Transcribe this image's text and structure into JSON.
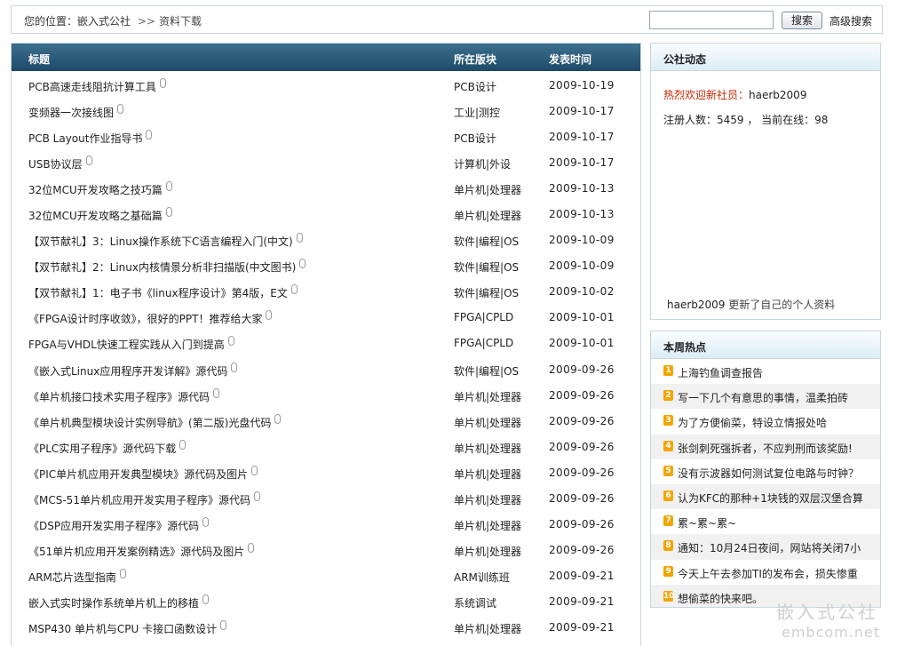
{
  "breadcrumb": {
    "prefix": "您的位置：",
    "site": "嵌入式公社",
    "separator": ">>",
    "current": "资料下载"
  },
  "search": {
    "value": "",
    "button": "搜索",
    "advanced": "高级搜索"
  },
  "table": {
    "headers": {
      "title": "标题",
      "forum": "所在版块",
      "date": "发表时间"
    },
    "rows": [
      {
        "title": "PCB高速走线阻抗计算工具",
        "forum": "PCB设计",
        "date": "2009-10-19"
      },
      {
        "title": "变频器一次接线图",
        "forum": "工业|测控",
        "date": "2009-10-17"
      },
      {
        "title": "PCB Layout作业指导书",
        "forum": "PCB设计",
        "date": "2009-10-17"
      },
      {
        "title": "USB协议层",
        "forum": "计算机|外设",
        "date": "2009-10-17"
      },
      {
        "title": "32位MCU开发攻略之技巧篇",
        "forum": "单片机|处理器",
        "date": "2009-10-13"
      },
      {
        "title": "32位MCU开发攻略之基础篇",
        "forum": "单片机|处理器",
        "date": "2009-10-13"
      },
      {
        "title": "【双节献礼】3：Linux操作系统下C语言编程入门(中文)",
        "forum": "软件|编程|OS",
        "date": "2009-10-09"
      },
      {
        "title": "【双节献礼】2：Linux内核情景分析非扫描版(中文图书)",
        "forum": "软件|编程|OS",
        "date": "2009-10-09"
      },
      {
        "title": "【双节献礼】1：电子书《linux程序设计》第4版，E文",
        "forum": "软件|编程|OS",
        "date": "2009-10-02"
      },
      {
        "title": "《FPGA设计时序收敛》，很好的PPT！推荐给大家",
        "forum": "FPGA|CPLD",
        "date": "2009-10-01"
      },
      {
        "title": "FPGA与VHDL快速工程实践从入门到提高",
        "forum": "FPGA|CPLD",
        "date": "2009-10-01"
      },
      {
        "title": "《嵌入式Linux应用程序开发详解》源代码",
        "forum": "软件|编程|OS",
        "date": "2009-09-26"
      },
      {
        "title": "《单片机接口技术实用子程序》源代码",
        "forum": "单片机|处理器",
        "date": "2009-09-26"
      },
      {
        "title": "《单片机典型模块设计实例导航》(第二版)光盘代码",
        "forum": "单片机|处理器",
        "date": "2009-09-26"
      },
      {
        "title": "《PLC实用子程序》源代码下载",
        "forum": "单片机|处理器",
        "date": "2009-09-26"
      },
      {
        "title": "《PIC单片机应用开发典型模块》源代码及图片",
        "forum": "单片机|处理器",
        "date": "2009-09-26"
      },
      {
        "title": "《MCS-51单片机应用开发实用子程序》源代码",
        "forum": "单片机|处理器",
        "date": "2009-09-26"
      },
      {
        "title": "《DSP应用开发实用子程序》源代码",
        "forum": "单片机|处理器",
        "date": "2009-09-26"
      },
      {
        "title": "《51单片机应用开发案例精选》源代码及图片",
        "forum": "单片机|处理器",
        "date": "2009-09-26"
      },
      {
        "title": "ARM芯片选型指南",
        "forum": "ARM训练班",
        "date": "2009-09-21"
      },
      {
        "title": "嵌入式实时操作系统单片机上的移植",
        "forum": "系统调试",
        "date": "2009-09-21"
      },
      {
        "title": "MSP430 单片机与CPU 卡接口函数设计",
        "forum": "单片机|处理器",
        "date": "2009-09-21"
      },
      {
        "title": "",
        "forum": "",
        "date": ""
      }
    ]
  },
  "community": {
    "title": "公社动态",
    "welcome_label": "热烈欢迎新社员：",
    "new_member": "haerb2009",
    "stats_text": "注册人数：5459 ， 当前在线：98",
    "activity_user": "haerb2009",
    "activity_text": "更新了自己的个人资料"
  },
  "hot": {
    "title": "本周热点",
    "items": [
      {
        "num": "1",
        "text": "上海钓鱼调查报告"
      },
      {
        "num": "2",
        "text": "写一下几个有意思的事情，温柔拍砖"
      },
      {
        "num": "3",
        "text": "为了方便偷菜，特设立情报处哈"
      },
      {
        "num": "4",
        "text": "张剑刺死强拆者，不应判刑而该奖励!"
      },
      {
        "num": "5",
        "text": "没有示波器如何测试复位电路与时钟？"
      },
      {
        "num": "6",
        "text": "认为KFC的那种+1块钱的双层汉堡合算"
      },
      {
        "num": "7",
        "text": "累~累~累~"
      },
      {
        "num": "8",
        "text": "通知：10月24日夜间，网站将关闭7小"
      },
      {
        "num": "9",
        "text": "今天上午去参加TI的发布会，损失惨重"
      },
      {
        "num": "10",
        "text": "想偷菜的快来吧。"
      }
    ]
  },
  "watermark": {
    "name": "嵌入式公社",
    "domain": "embcom.net"
  }
}
